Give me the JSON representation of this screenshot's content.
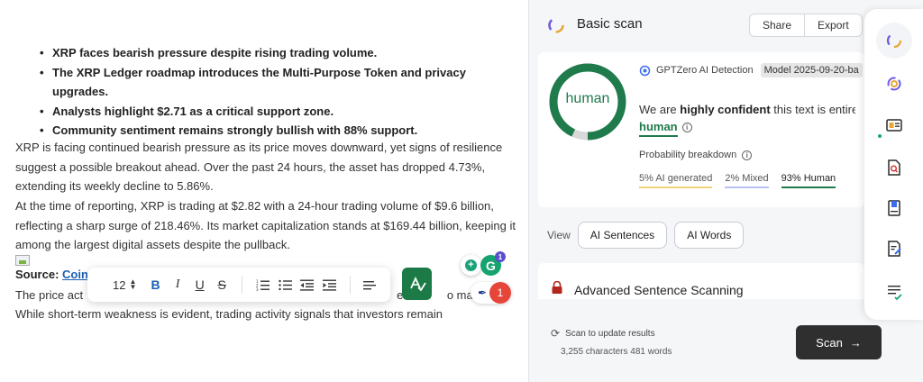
{
  "editor": {
    "bullets": [
      "XRP faces bearish pressure despite rising trading volume.",
      "The XRP Ledger roadmap introduces the Multi-Purpose Token and privacy upgrades.",
      "Analysts highlight $2.71 as a critical support zone.",
      "Community sentiment remains strongly bullish with 88% support."
    ],
    "paragraph_1": "XRP is facing continued bearish pressure as its price moves downward, yet signs of resilience suggest a possible breakout ahead. Over the past 24 hours, the asset has dropped 4.73%, extending its weekly decline to 5.86%.",
    "paragraph_2": "At the time of reporting, XRP is trading at $2.82 with a 24-hour trading volume of $9.6 billion, reflecting a sharp surge of 218.46%. Its market capitalization stands at $169.44 billion, keeping it among the largest digital assets despite the pullback.",
    "source_label": "Source:",
    "source_link": "Coin",
    "paragraph_3_start": "The price act",
    "paragraph_3_end": "er c",
    "paragraph_3_tail": "o marke",
    "paragraph_4": "While short-term weakness is evident, trading activity signals that investors remain",
    "toolbar": {
      "font_size": "12",
      "bold": "B",
      "italic": "I",
      "underline": "U",
      "strike": "S"
    },
    "grammarly_badge": "1",
    "feather_badge": "1"
  },
  "panel": {
    "title": "Basic scan",
    "share": "Share",
    "export": "Export",
    "result_label": "human",
    "human_fraction": 0.93,
    "detector_name": "GPTZero AI Detection",
    "model_tag": "Model 2025-09-20-ba",
    "confidence_prefix": "We are ",
    "confidence_bold": "highly confident",
    "confidence_suffix": " this text is entire",
    "confidence_result": "human",
    "probability_label": "Probability breakdown",
    "chip_ai": "5% AI generated",
    "chip_mixed": "2% Mixed",
    "chip_human": "93% Human",
    "view_label": "View",
    "ai_sentences": "AI Sentences",
    "ai_words": "AI Words",
    "advanced_label": "Advanced Sentence Scanning",
    "scan_hint": "Scan to update results",
    "counts": "3,255 characters 481 words",
    "scan_button": "Scan"
  },
  "colors": {
    "human_green": "#1f7a4c",
    "donut_rest": "#d9d9d9",
    "scan_button": "#2f2f2f"
  }
}
